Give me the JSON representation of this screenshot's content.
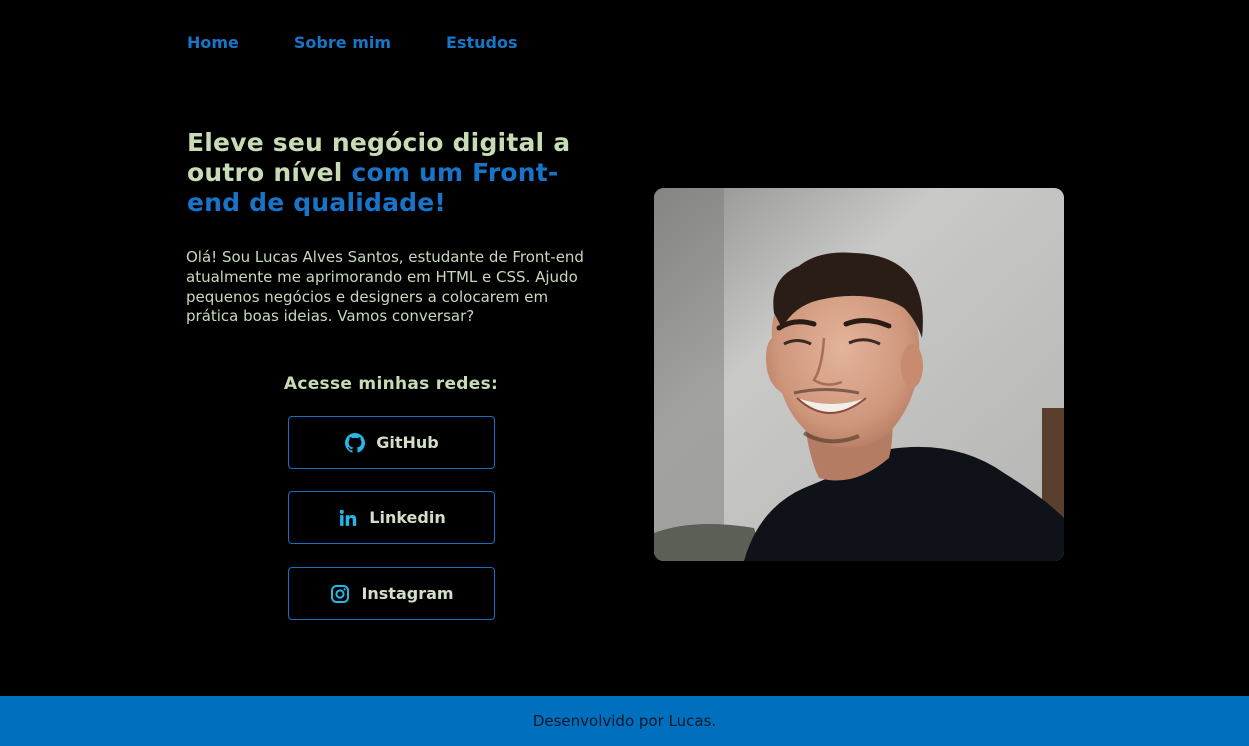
{
  "nav": {
    "items": [
      {
        "label": "Home"
      },
      {
        "label": "Sobre mim"
      },
      {
        "label": "Estudos"
      }
    ],
    "color": "#1875c7"
  },
  "hero": {
    "headline_part1": "Eleve seu negócio digital a outro nível",
    "headline_part2": "com um Front-end de qualidade!",
    "intro": "Olá! Sou Lucas Alves Santos, estudante de Front-end atualmente me aprimorando em HTML e CSS. Ajudo pequenos negócios e designers a colocarem em prática boas ideias. Vamos conversar?"
  },
  "socials": {
    "title": "Acesse minhas redes:",
    "buttons": [
      {
        "label": "GitHub",
        "icon": "github-icon"
      },
      {
        "label": "Linkedin",
        "icon": "linkedin-icon"
      },
      {
        "label": "Instagram",
        "icon": "instagram-icon"
      }
    ],
    "icon_color": "#28b6e6"
  },
  "photo": {
    "alt": "profile-photo"
  },
  "footer": {
    "text": "Desenvolvido por Lucas.",
    "background": "#006fbe"
  },
  "colors": {
    "background": "#000000",
    "accent": "#1774c9",
    "text_light": "#c7dbb5"
  }
}
